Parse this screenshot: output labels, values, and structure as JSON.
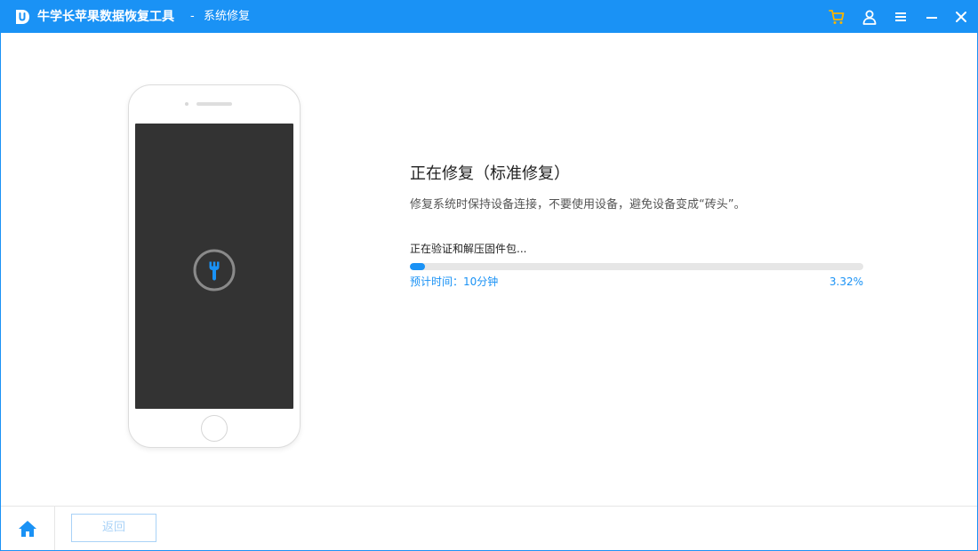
{
  "window": {
    "app_title": "牛学长苹果数据恢复工具",
    "separator": "-",
    "section_title": "系统修复"
  },
  "titlebar_icons": [
    "cart-icon",
    "user-icon",
    "menu-icon",
    "minimize-icon",
    "close-icon"
  ],
  "colors": {
    "accent": "#1a92f5",
    "cart_icon": "#f7b500",
    "phone_screen": "#333333",
    "progress_track": "#e6e6e6",
    "disabled_button": "#a9d2f7"
  },
  "repair": {
    "title": "正在修复（标准修复）",
    "description": "修复系统时保持设备连接，不要使用设备，避免设备变成“砖头”。",
    "progress_status": "正在验证和解压固件包...",
    "eta": "预计时间：10分钟",
    "percent_label": "3.32%",
    "progress_fraction": 0.0332
  },
  "bottom_bar": {
    "home_icon": "home-icon",
    "back_label": "返回"
  }
}
